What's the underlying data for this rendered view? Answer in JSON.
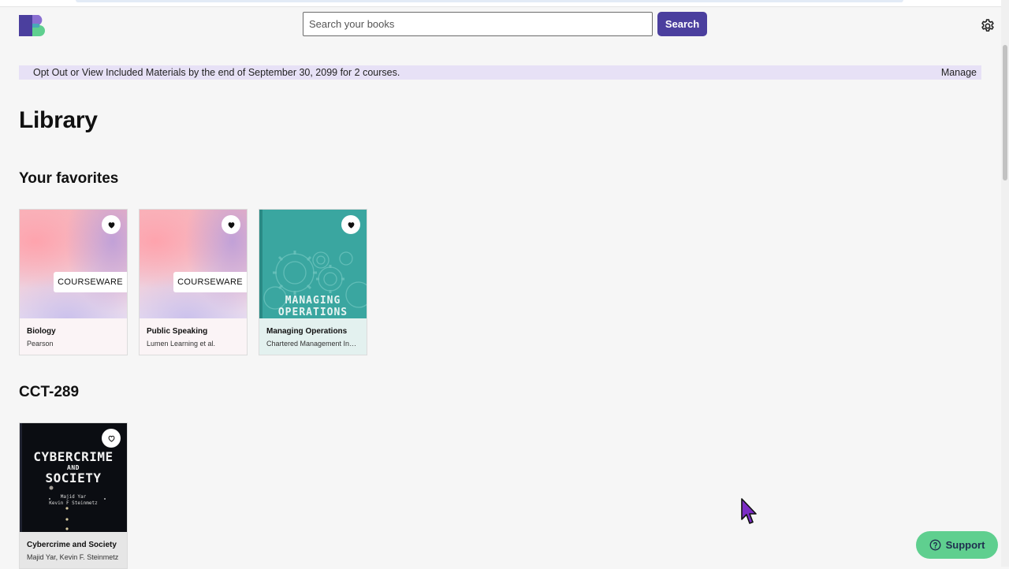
{
  "search": {
    "placeholder": "Search your books",
    "button_label": "Search"
  },
  "banner": {
    "message": "Opt Out or View Included Materials by the end of September 30, 2099 for 2 courses.",
    "manage_label": "Manage"
  },
  "page_title": "Library",
  "favorites": {
    "heading": "Your favorites",
    "books": [
      {
        "title": "Biology",
        "author": "Pearson",
        "badge": "COURSEWARE",
        "favorited": true,
        "icon": "heart-filled-icon"
      },
      {
        "title": "Public Speaking",
        "author": "Lumen Learning et al.",
        "badge": "COURSEWARE",
        "favorited": true,
        "icon": "heart-filled-icon"
      },
      {
        "title": "Managing Operations",
        "author": "Chartered Management Ins…",
        "cover_text": [
          "MANAGING",
          "OPERATIONS"
        ],
        "favorited": true,
        "icon": "heart-filled-icon"
      }
    ]
  },
  "course": {
    "heading": "CCT-289",
    "books": [
      {
        "title": "Cybercrime and Society",
        "author": "Majid Yar, Kevin F. Steinmetz",
        "cover_title_1": "CYBERCRIME",
        "cover_and": "AND",
        "cover_title_2": "SOCIETY",
        "cover_authors_1": "Majid Yar",
        "cover_authors_2": "Kevin F Steinmetz",
        "favorited": false,
        "icon": "heart-outline-icon"
      }
    ]
  },
  "support": {
    "label": "Support"
  },
  "colors": {
    "accent": "#4b3f9e",
    "banner_bg": "#e7e1f6",
    "support_bg": "#5fcf8f",
    "teal_cover": "#3aa6a0"
  }
}
